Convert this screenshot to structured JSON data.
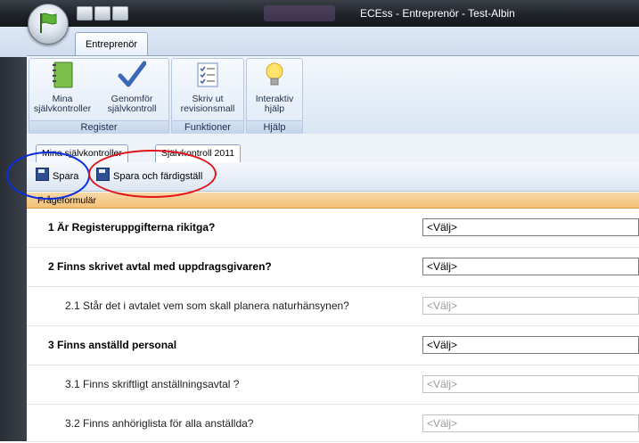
{
  "window": {
    "title": "ECEss - Entreprenör - Test-Albin"
  },
  "ribbon": {
    "tab": "Entreprenör",
    "groups": [
      {
        "label": "Register",
        "buttons": [
          {
            "line1": "Mina",
            "line2": "självkontroller",
            "icon": "notebook-icon"
          },
          {
            "line1": "Genomför",
            "line2": "självkontroll",
            "icon": "checkmark-icon"
          }
        ]
      },
      {
        "label": "Funktioner",
        "buttons": [
          {
            "line1": "Skriv ut",
            "line2": "revisionsmall",
            "icon": "checklist-icon"
          }
        ]
      },
      {
        "label": "Hjälp",
        "buttons": [
          {
            "line1": "Interaktiv",
            "line2": "hjälp",
            "icon": "lightbulb-icon"
          }
        ]
      }
    ]
  },
  "doc_tabs": [
    "Mina självkontroller",
    "Självkontroll 2011"
  ],
  "toolbar": {
    "save": "Spara",
    "save_finish": "Spara och färdigställ"
  },
  "form": {
    "header": "Frågeformulär",
    "rows": [
      {
        "text": "1 Är Registeruppgifterna rikitga?",
        "value": "<Välj>"
      },
      {
        "text": "2 Finns skrivet avtal med uppdragsgivaren?",
        "value": "<Välj>"
      },
      {
        "text": "2.1 Står det i avtalet vem som skall planera naturhänsynen?",
        "value": "<Välj>"
      },
      {
        "text": "3 Finns anställd personal",
        "value": "<Välj>"
      },
      {
        "text": "3.1 Finns skriftligt anställningsavtal ?",
        "value": "<Välj>"
      },
      {
        "text": "3.2 Finns anhöriglista för alla anställda?",
        "value": "<Välj>"
      }
    ]
  },
  "colors": {
    "annotation_blue": "#0a2de0",
    "annotation_red": "#e0141b",
    "section_header": "#f2c178"
  }
}
